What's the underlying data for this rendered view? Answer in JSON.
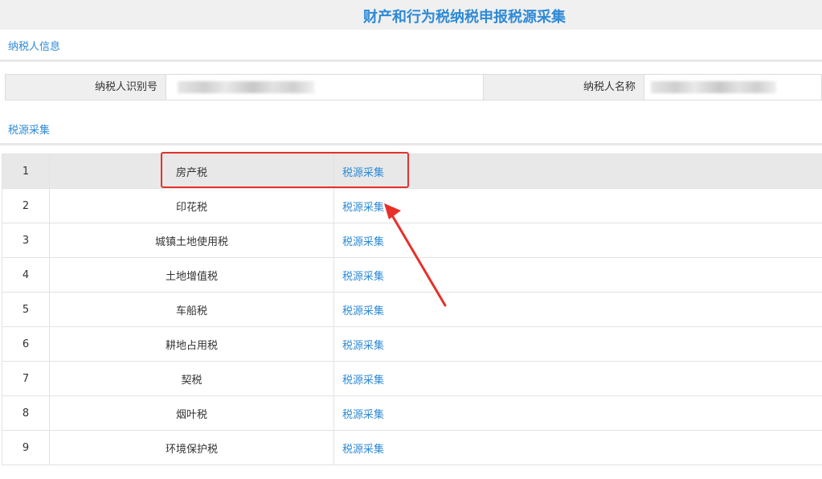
{
  "header": {
    "title": "财产和行为税纳税申报税源采集"
  },
  "tabs": {
    "taxpayer_info": "纳税人信息",
    "source_collection": "税源采集"
  },
  "taxpayer": {
    "id_label": "纳税人识别号",
    "name_label": "纳税人名称"
  },
  "rows": [
    {
      "index": "1",
      "name": "房产税",
      "action": "税源采集"
    },
    {
      "index": "2",
      "name": "印花税",
      "action": "税源采集"
    },
    {
      "index": "3",
      "name": "城镇土地使用税",
      "action": "税源采集"
    },
    {
      "index": "4",
      "name": "土地增值税",
      "action": "税源采集"
    },
    {
      "index": "5",
      "name": "车船税",
      "action": "税源采集"
    },
    {
      "index": "6",
      "name": "耕地占用税",
      "action": "税源采集"
    },
    {
      "index": "7",
      "name": "契税",
      "action": "税源采集"
    },
    {
      "index": "8",
      "name": "烟叶税",
      "action": "税源采集"
    },
    {
      "index": "9",
      "name": "环境保护税",
      "action": "税源采集"
    }
  ],
  "colors": {
    "accent": "#2e8ad6",
    "highlight": "#e8302a"
  }
}
